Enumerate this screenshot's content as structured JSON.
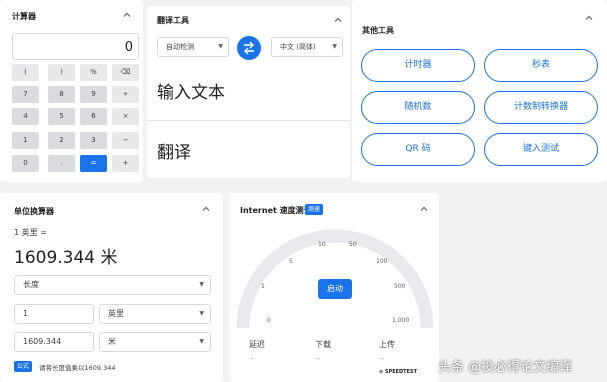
{
  "calculator": {
    "title": "计算器",
    "display": "0",
    "keys": [
      [
        "(",
        ")",
        "%",
        "⌫"
      ],
      [
        "7",
        "8",
        "9",
        "÷"
      ],
      [
        "4",
        "5",
        "6",
        "×"
      ],
      [
        "1",
        "2",
        "3",
        "−"
      ],
      [
        "0",
        ".",
        "=",
        "+"
      ]
    ]
  },
  "translate": {
    "title": "翻译工具",
    "source_lang": "自动检测",
    "target_lang": "中文 (简体)",
    "input_placeholder": "输入文本",
    "output_label": "翻译"
  },
  "other_tools": {
    "title": "其他工具",
    "items": [
      "计时器",
      "秒表",
      "随机数",
      "计数制转换器",
      "QR 码",
      "键入测试"
    ]
  },
  "unit_converter": {
    "title": "单位换算器",
    "input_expr": "1 英里 =",
    "result": "1609.344 米",
    "category": "长度",
    "from_value": "1",
    "from_unit": "英里",
    "to_value": "1609.344",
    "to_unit": "米",
    "formula_badge": "公式",
    "formula": "请将长度值乘以1609.344"
  },
  "speed_test": {
    "title": "Internet 速度测试",
    "badge": "测速",
    "ticks": [
      "0",
      "1",
      "5",
      "10",
      "50",
      "100",
      "500",
      "1,000"
    ],
    "start": "启动",
    "metrics": [
      {
        "label": "延迟",
        "value": "-"
      },
      {
        "label": "下载",
        "value": "-"
      },
      {
        "label": "上传",
        "value": "-"
      }
    ],
    "provider": "⊙ SPEEDTEST"
  },
  "watermark": "头条 @投必得论文编译",
  "colors": {
    "accent": "#1a73e8",
    "background": "#f1f2f4"
  }
}
